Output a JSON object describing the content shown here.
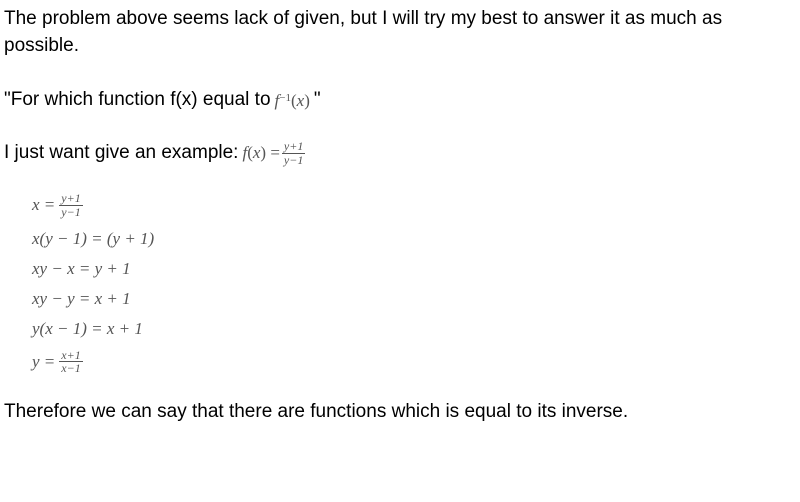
{
  "intro": "The problem above seems lack of given, but I will try my best to answer it as much as possible.",
  "question": {
    "prefix": "\"For which function f(x) equal to ",
    "math": "f^{-1}(x)",
    "suffix": "\""
  },
  "example": {
    "prefix": "I just want give an example: ",
    "lhs": "f(x) = ",
    "frac_num": "y+1",
    "frac_den": "y−1"
  },
  "steps": [
    {
      "type": "frac",
      "lhs": "x = ",
      "num": "y+1",
      "den": "y−1"
    },
    {
      "type": "plain",
      "text": "x(y − 1) = (y + 1)"
    },
    {
      "type": "plain",
      "text": "xy − x = y + 1"
    },
    {
      "type": "plain",
      "text": "xy − y = x + 1"
    },
    {
      "type": "plain",
      "text": "y(x − 1) = x + 1"
    },
    {
      "type": "frac",
      "lhs": "y = ",
      "num": "x+1",
      "den": "x−1"
    }
  ],
  "conclusion": "Therefore we can say that there are functions which is equal to its inverse."
}
